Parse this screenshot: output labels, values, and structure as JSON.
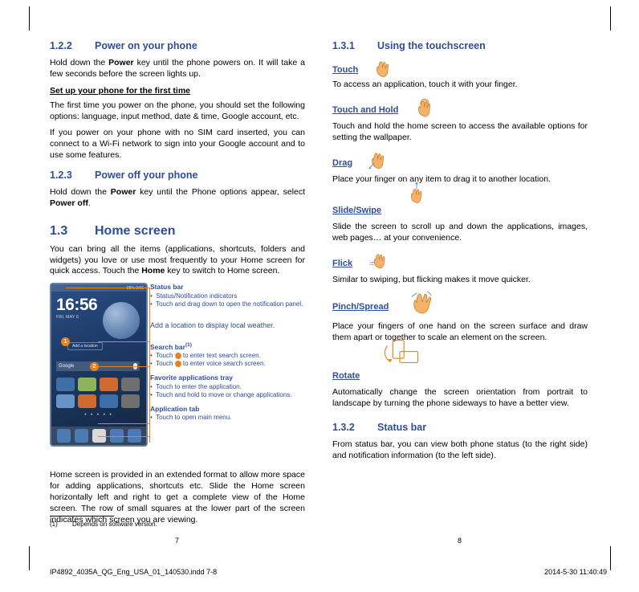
{
  "crop_marks": true,
  "left_column": {
    "sections": [
      {
        "number": "1.2.2",
        "title": "Power on your phone",
        "paragraphs": [
          "Hold down the Power key until the phone powers on. It will take a few seconds before the screen lights up."
        ]
      }
    ],
    "subhead_setup": "Set up your phone for the first time",
    "setup_paragraphs": [
      "The first time you power on the phone, you should set the following options: language, input method, date & time, Google account, etc.",
      "If you power on your phone with no SIM card inserted, you can connect to a Wi-Fi network to sign into your Google account and to use some features."
    ],
    "section_123": {
      "number": "1.2.3",
      "title": "Power off your phone",
      "paragraph": "Hold down the Power key until the Phone options appear, select Power off."
    },
    "section_13": {
      "number": "1.3",
      "title": "Home screen",
      "paragraph": "You can bring all the items (applications, shortcuts, folders and widgets) you love or use most frequently to your Home screen for quick access. Touch the Home key to switch to Home screen."
    },
    "callouts": {
      "status_bar": {
        "title": "Status bar",
        "bullets": [
          "Status/Notification indicators",
          "Touch and drag down to open the notification panel."
        ]
      },
      "add_location": {
        "text": "Add a location to display local weather."
      },
      "search_bar": {
        "title": "Search bar",
        "footnote_mark": "(1)",
        "bullets": [
          "Touch ❶ to enter text search screen.",
          "Touch ❷ to enter voice search screen."
        ]
      },
      "favorite_tray": {
        "title": "Favorite applications tray",
        "bullets": [
          "Touch to enter the application.",
          "Touch and hold to move or change applications."
        ]
      },
      "application_tab": {
        "title": "Application tab",
        "bullets": [
          "Touch to open main menu."
        ]
      }
    },
    "phone_mock": {
      "status_left": "",
      "status_right": "98%  9:56",
      "clock": "16:56",
      "clock_sub": "FRI, MAY 6",
      "add_location_chip": "Add a location",
      "search_placeholder": "Google",
      "page_dots": "• • • • •"
    },
    "closing_paragraph": "Home screen is provided in an extended format to allow more space for adding applications, shortcuts etc. Slide the Home screen horizontally left and right to get a complete view of the Home screen. The row of small squares at the lower part of the screen indicates which screen you are viewing."
  },
  "right_column": {
    "section_131": {
      "number": "1.3.1",
      "title": "Using the touchscreen"
    },
    "gestures": [
      {
        "name": "Touch",
        "icon": "hand-touch-icon",
        "text": "To access an application, touch it with your finger."
      },
      {
        "name": "Touch and Hold",
        "icon": "hand-touch-hold-icon",
        "text": "Touch and hold the home screen to access the available options for setting the wallpaper."
      },
      {
        "name": "Drag",
        "icon": "hand-drag-icon",
        "text": "Place your finger on any item to drag it to another location."
      },
      {
        "name": "Slide/Swipe",
        "icon": "hand-slide-icon",
        "text": "Slide the screen to scroll up and down the applications, images, web pages… at your convenience."
      },
      {
        "name": "Flick",
        "icon": "hand-flick-icon",
        "text": "Similar to swiping, but flicking makes it move quicker."
      },
      {
        "name": "Pinch/Spread",
        "icon": "hand-pinch-icon",
        "text": "Place your fingers of one hand on the screen surface and draw them apart or together to scale an element on the screen."
      },
      {
        "name": "Rotate",
        "icon": "phone-rotate-icon",
        "text": "Automatically change the screen orientation from portrait to landscape by turning the phone sideways to have a better view."
      }
    ],
    "section_132": {
      "number": "1.3.2",
      "title": "Status bar",
      "paragraph": "From status bar, you can view both phone status (to the right side) and notification information (to the left side)."
    }
  },
  "footer": {
    "footnote_mark": "(1)",
    "footnote_text": "Depends on software version.",
    "page_left": "7",
    "page_right": "8",
    "file_line": "IP4892_4035A_QG_Eng_USA_01_140530.indd   7-8",
    "timestamp": "2014-5-30   11:40:49"
  },
  "colors": {
    "heading_blue": "#2d4e9b",
    "callout_orange": "#e8821b",
    "text_black": "#000000"
  }
}
